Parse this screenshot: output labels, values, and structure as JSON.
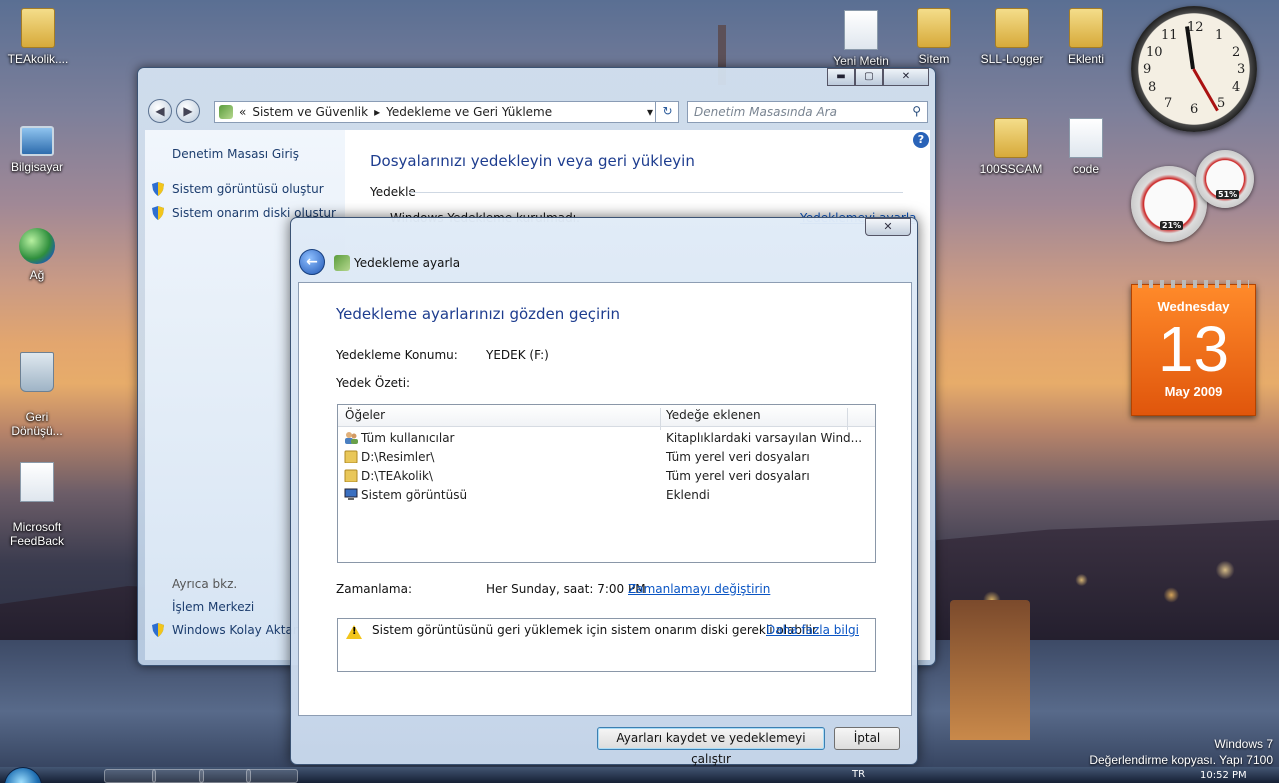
{
  "desktop": {
    "icons": {
      "teakolik": "TEAkolik....",
      "bilgisayar": "Bilgisayar",
      "ag": "Ağ",
      "geri_donusum": "Geri\nDönüşü...",
      "feedback": "Microsoft\nFeedBack",
      "yeni_metin": "Yeni Metin",
      "sitem": "Sitem",
      "sll_logger": "SLL-Logger",
      "eklenti": "Eklenti",
      "ssscam": "100SSCAM",
      "code": "code"
    },
    "watermark": {
      "line1": "Windows 7",
      "line2": "Değerlendirme kopyası. Yapı 7100"
    }
  },
  "gadgets": {
    "clock_numbers": [
      "12",
      "1",
      "2",
      "3",
      "4",
      "5",
      "6",
      "7",
      "8",
      "9",
      "10",
      "11"
    ],
    "cpu_percent": "21%",
    "mem_percent": "51%",
    "calendar": {
      "weekday": "Wednesday",
      "day": "13",
      "month_year": "May 2009"
    }
  },
  "control_panel": {
    "address": {
      "prefix": "«",
      "crumb1": "Sistem ve Güvenlik",
      "crumb2": "Yedekleme ve Geri Yükleme"
    },
    "search_placeholder": "Denetim Masasında Ara",
    "left": {
      "home": "Denetim Masası Giriş",
      "create_image": "Sistem görüntüsü oluştur",
      "create_repair": "Sistem onarım diski oluştur",
      "see_also": "Ayrıca bkz.",
      "action_center": "İşlem Merkezi",
      "easy_transfer": "Windows Kolay Aktarımı"
    },
    "main": {
      "title": "Dosyalarınızı yedekleyin veya geri yükleyin",
      "section": "Yedekle",
      "status": "Windows Yedekleme kurulmadı.",
      "setup_link": "Yedeklemeyi ayarla"
    }
  },
  "dialog": {
    "title": "Yedekleme ayarla",
    "heading": "Yedekleme ayarlarınızı gözden geçirin",
    "location_label": "Yedekleme Konumu:",
    "location_value": "YEDEK (F:)",
    "summary_label": "Yedek Özeti:",
    "columns": [
      "Öğeler",
      "Yedeğe eklenen"
    ],
    "rows": [
      {
        "item": "Tüm kullanıcılar",
        "included": "Kitaplıklardaki varsayılan Wind...",
        "icon": "users-icon"
      },
      {
        "item": "D:\\Resimler\\",
        "included": "Tüm yerel veri dosyaları",
        "icon": "folder-icon"
      },
      {
        "item": "D:\\TEAkolik\\",
        "included": "Tüm yerel veri dosyaları",
        "icon": "folder-icon"
      },
      {
        "item": "Sistem görüntüsü",
        "included": "Eklendi",
        "icon": "system-image-icon"
      }
    ],
    "schedule_label": "Zamanlama:",
    "schedule_value": "Her Sunday, saat: 7:00 PM",
    "schedule_link": "Zamanlamayı değiştirin",
    "warning_text": "Sistem görüntüsünü geri yüklemek için sistem onarım diski gerekli olabilir.",
    "warning_link": "Daha fazla bilgi",
    "save_button": "Ayarları kaydet ve yedeklemeyi çalıştır",
    "cancel_button": "İptal"
  },
  "taskbar": {
    "lang": "TR",
    "time": "10:52 PM"
  },
  "colors": {
    "accent_title": "#1e3d8f",
    "link": "#0a55c4",
    "calendar": "#e86a1c"
  }
}
